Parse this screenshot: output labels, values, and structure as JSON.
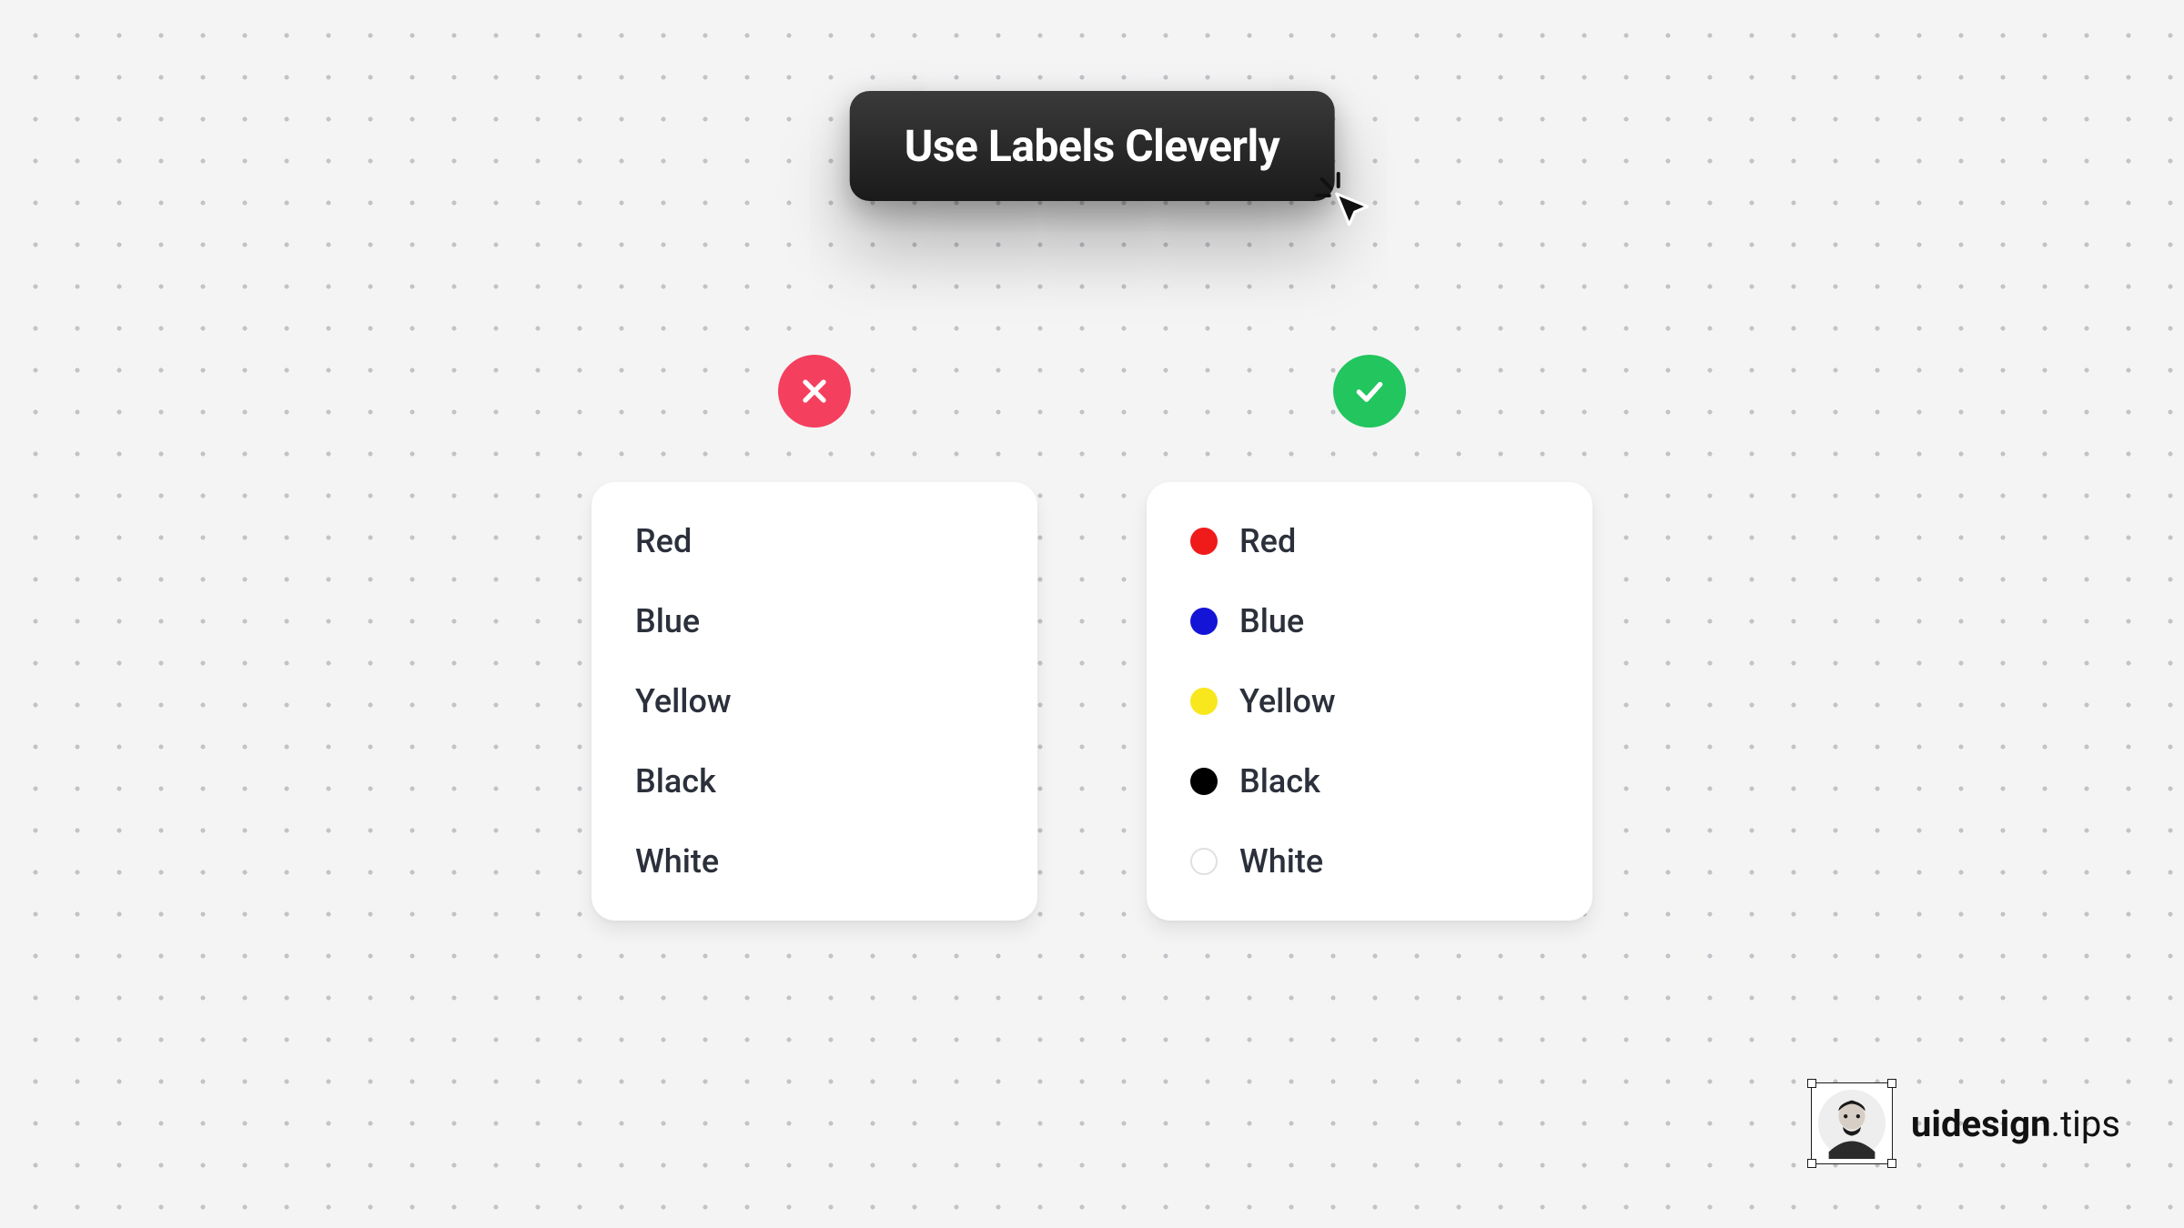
{
  "title": "Use Labels Cleverly",
  "bad": {
    "items": [
      {
        "label": "Red"
      },
      {
        "label": "Blue"
      },
      {
        "label": "Yellow"
      },
      {
        "label": "Black"
      },
      {
        "label": "White"
      }
    ]
  },
  "good": {
    "items": [
      {
        "label": "Red",
        "swatch": "#ef1a1a",
        "outline": false
      },
      {
        "label": "Blue",
        "swatch": "#1414d6",
        "outline": false
      },
      {
        "label": "Yellow",
        "swatch": "#f8e71c",
        "outline": false
      },
      {
        "label": "Black",
        "swatch": "#000000",
        "outline": false
      },
      {
        "label": "White",
        "swatch": "#ffffff",
        "outline": true
      }
    ]
  },
  "attribution": {
    "brand_bold": "uidesign",
    "brand_rest": ".tips"
  },
  "colors": {
    "bad_badge": "#f43f5e",
    "good_badge": "#22c55e",
    "page_bg": "#f4f4f5"
  }
}
